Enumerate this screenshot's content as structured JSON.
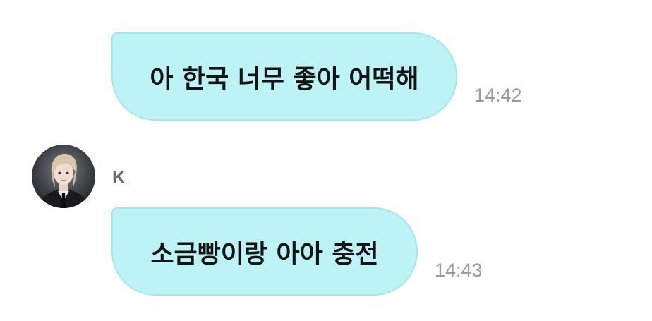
{
  "messages": [
    {
      "direction": "outgoing",
      "text": "아 한국 너무 좋아 어떡해",
      "time": "14:42"
    },
    {
      "direction": "incoming",
      "sender": "K",
      "text": "소금빵이랑 아아 충전",
      "time": "14:43"
    }
  ],
  "colors": {
    "bubble_fill": "#bdf3f5",
    "bubble_border": "#a6e7eb",
    "timestamp_text": "#9a9a9a",
    "sender_text": "#6a6a6a",
    "message_text": "#141414"
  },
  "icons": {
    "avatar": "profile-photo-avatar"
  }
}
